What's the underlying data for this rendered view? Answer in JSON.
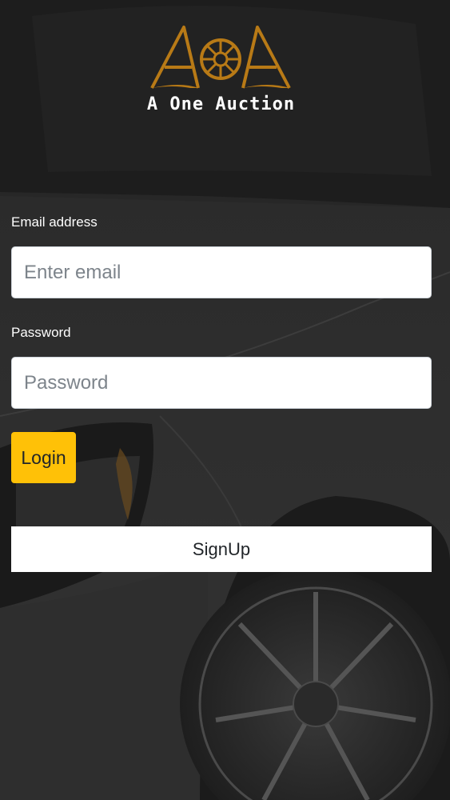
{
  "brand": {
    "name": "A One Auction",
    "accent_color": "#b87a16"
  },
  "login_form": {
    "email_label": "Email address",
    "email_placeholder": "Enter email",
    "email_value": "",
    "password_label": "Password",
    "password_placeholder": "Password",
    "password_value": "",
    "login_label": "Login",
    "login_color": "#ffc107",
    "signup_label": "SignUp"
  },
  "background": {
    "description_icon": "dark-car-photo"
  }
}
